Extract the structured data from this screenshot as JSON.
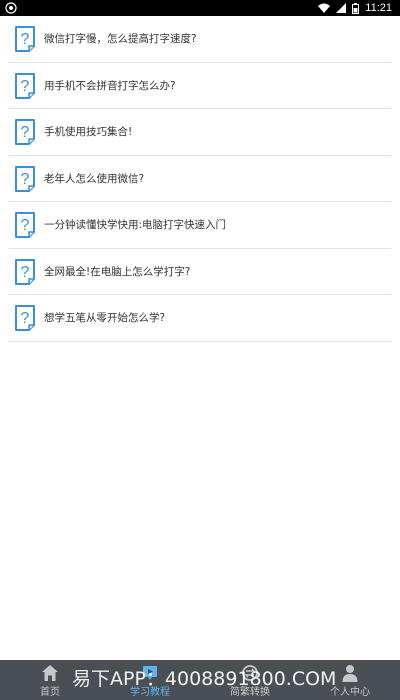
{
  "status_bar": {
    "time": "11:21"
  },
  "items": [
    {
      "label": "微信打字慢，怎么提高打字速度?"
    },
    {
      "label": "用手机不会拼音打字怎么办?"
    },
    {
      "label": "手机使用技巧集合!"
    },
    {
      "label": "老年人怎么使用微信?"
    },
    {
      "label": "一分钟读懂快学快用:电脑打字快速入门"
    },
    {
      "label": "全网最全!在电脑上怎么学打字?"
    },
    {
      "label": "想学五笔从零开始怎么学?"
    }
  ],
  "nav": {
    "tabs": [
      {
        "label": "首页",
        "icon": "home-icon"
      },
      {
        "label": "学习教程",
        "icon": "tutorial-icon",
        "active": true
      },
      {
        "label": "简繁转换",
        "icon": "convert-icon"
      },
      {
        "label": "个人中心",
        "icon": "user-icon"
      }
    ]
  },
  "watermark": "易下APP：4008891800.COM",
  "colors": {
    "status_bar": "#000000",
    "nav_bg": "#4a4f55",
    "nav_active": "#5fb4f0",
    "icon_blue": "#3d8fd6",
    "divider": "#e3e3e3"
  }
}
